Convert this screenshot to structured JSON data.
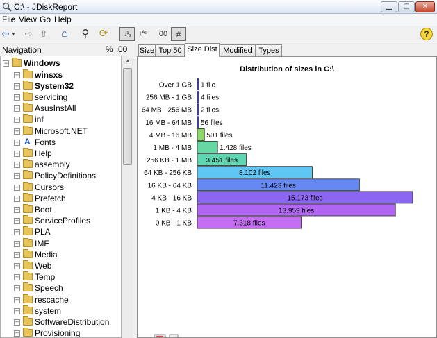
{
  "window": {
    "title": "C:\\ - JDiskReport",
    "min_label": "▁",
    "max_label": "▢",
    "close_label": "✕"
  },
  "menu": [
    "File",
    "View",
    "Go",
    "Help"
  ],
  "toolbar": {
    "back": "⇦",
    "back_drop": "▾",
    "forward": "⇨",
    "up": "⇧",
    "home": "⌂",
    "search": "⚲",
    "refresh": "⟳",
    "sort_desc": "↓¹₉",
    "sort_asc": "↓ᴬᶻ",
    "size_toggle": "00",
    "count_toggle": "#",
    "help": "?"
  },
  "navigation": {
    "title": "Navigation",
    "pct_label": "%",
    "size_label": "00",
    "root": "Windows",
    "items": [
      {
        "label": "winsxs",
        "bold": true,
        "icon": "folder"
      },
      {
        "label": "System32",
        "bold": true,
        "icon": "folder"
      },
      {
        "label": "servicing",
        "bold": false,
        "icon": "folder"
      },
      {
        "label": "AsusInstAll",
        "bold": false,
        "icon": "folder"
      },
      {
        "label": "inf",
        "bold": false,
        "icon": "folder"
      },
      {
        "label": "Microsoft.NET",
        "bold": false,
        "icon": "folder"
      },
      {
        "label": "Fonts",
        "bold": false,
        "icon": "fonts"
      },
      {
        "label": "Help",
        "bold": false,
        "icon": "folder"
      },
      {
        "label": "assembly",
        "bold": false,
        "icon": "folder"
      },
      {
        "label": "PolicyDefinitions",
        "bold": false,
        "icon": "folder"
      },
      {
        "label": "Cursors",
        "bold": false,
        "icon": "folder"
      },
      {
        "label": "Prefetch",
        "bold": false,
        "icon": "folder"
      },
      {
        "label": "Boot",
        "bold": false,
        "icon": "folder"
      },
      {
        "label": "ServiceProfiles",
        "bold": false,
        "icon": "folder"
      },
      {
        "label": "PLA",
        "bold": false,
        "icon": "folder"
      },
      {
        "label": "IME",
        "bold": false,
        "icon": "folder"
      },
      {
        "label": "Media",
        "bold": false,
        "icon": "folder"
      },
      {
        "label": "Web",
        "bold": false,
        "icon": "folder"
      },
      {
        "label": "Temp",
        "bold": false,
        "icon": "folder"
      },
      {
        "label": "Speech",
        "bold": false,
        "icon": "folder"
      },
      {
        "label": "rescache",
        "bold": false,
        "icon": "folder"
      },
      {
        "label": "system",
        "bold": false,
        "icon": "folder"
      },
      {
        "label": "SoftwareDistribution",
        "bold": false,
        "icon": "folder"
      },
      {
        "label": "Provisioning",
        "bold": false,
        "icon": "folder"
      }
    ]
  },
  "tabs": [
    "Size",
    "Top 50",
    "Size Dist",
    "Modified",
    "Types"
  ],
  "active_tab": "Size Dist",
  "chart_data": {
    "type": "bar",
    "orientation": "horizontal",
    "title": "Distribution of sizes in C:\\",
    "categories": [
      "Over 1 GB",
      "256 MB - 1 GB",
      "64 MB - 256 MB",
      "16 MB - 64 MB",
      "4 MB - 16 MB",
      "1 MB - 4 MB",
      "256 KB - 1 MB",
      "64 KB - 256 KB",
      "16 KB - 64 KB",
      "4 KB - 16 KB",
      "1 KB - 4 KB",
      "0 KB - 1 KB"
    ],
    "values": [
      1,
      4,
      2,
      56,
      501,
      1428,
      3451,
      8102,
      11423,
      15173,
      13959,
      7318
    ],
    "labels": [
      "1 file",
      "4 files",
      "2 files",
      "56 files",
      "501 files",
      "1.428 files",
      "3.451 files",
      "8.102 files",
      "11.423 files",
      "15.173 files",
      "13.959 files",
      "7.318 files"
    ],
    "colors": [
      "#3a3f9c",
      "#3a3f9c",
      "#3a3f9c",
      "#3a3f9c",
      "#8cd86a",
      "#66d9a2",
      "#5ed6b2",
      "#5fc6f4",
      "#6688f2",
      "#8a66f3",
      "#b066f3",
      "#c46cf2"
    ],
    "xlim": [
      0,
      15173
    ]
  }
}
